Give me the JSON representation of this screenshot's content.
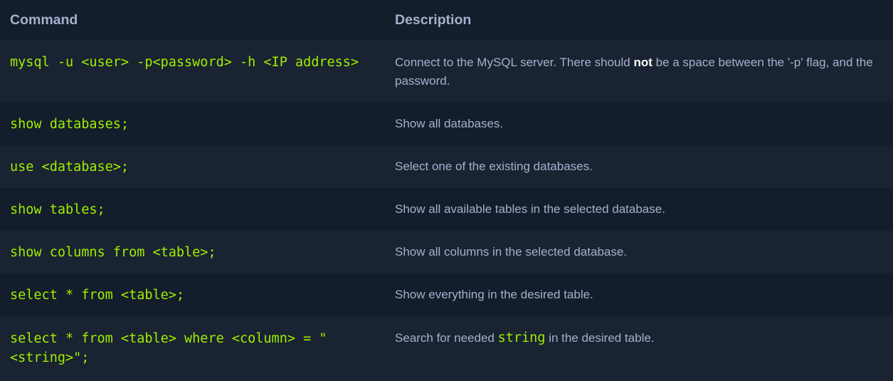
{
  "header": {
    "command": "Command",
    "description": "Description"
  },
  "rows": [
    {
      "command": "mysql -u <user> -p<password> -h <IP address>",
      "desc_before": "Connect to the MySQL server. There should ",
      "desc_bold": "not",
      "desc_after": " be a space between the '-p' flag, and the password."
    },
    {
      "command": "show databases;",
      "description": "Show all databases."
    },
    {
      "command": "use <database>;",
      "description": "Select one of the existing databases."
    },
    {
      "command": "show tables;",
      "description": "Show all available tables in the selected database."
    },
    {
      "command": "show columns from <table>;",
      "description": "Show all columns in the selected database."
    },
    {
      "command": "select * from <table>;",
      "description": "Show everything in the desired table."
    },
    {
      "command": "select * from <table> where <column> = \"<string>\";",
      "desc_before": "Search for needed ",
      "desc_code": "string",
      "desc_after": " in the desired table."
    }
  ]
}
